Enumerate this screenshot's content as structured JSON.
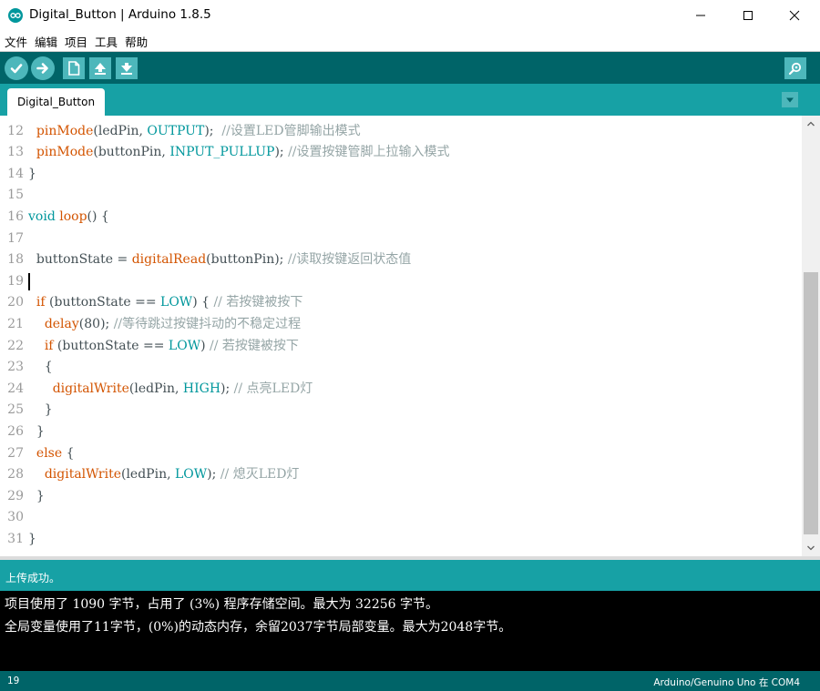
{
  "window": {
    "title": "Digital_Button | Arduino 1.8.5"
  },
  "menu": {
    "items": [
      "文件",
      "编辑",
      "项目",
      "工具",
      "帮助"
    ]
  },
  "toolbar": {
    "buttons": [
      "verify-icon",
      "upload-icon",
      "new-icon",
      "open-icon",
      "save-icon",
      "serial-monitor-icon"
    ]
  },
  "tabs": [
    {
      "label": "Digital_Button",
      "active": true
    }
  ],
  "editor": {
    "caret_line": 19,
    "lines": [
      {
        "num": "12",
        "segments": [
          {
            "t": "  ",
            "c": "plain"
          },
          {
            "t": "pinMode",
            "c": "kw"
          },
          {
            "t": "(ledPin, ",
            "c": "plain"
          },
          {
            "t": "OUTPUT",
            "c": "const"
          },
          {
            "t": ");  ",
            "c": "plain"
          },
          {
            "t": "//设置LED管脚输出模式",
            "c": "cmt"
          }
        ]
      },
      {
        "num": "13",
        "segments": [
          {
            "t": "  ",
            "c": "plain"
          },
          {
            "t": "pinMode",
            "c": "kw"
          },
          {
            "t": "(buttonPin, ",
            "c": "plain"
          },
          {
            "t": "INPUT_PULLUP",
            "c": "const"
          },
          {
            "t": "); ",
            "c": "plain"
          },
          {
            "t": "//设置按键管脚上拉输入模式",
            "c": "cmt"
          }
        ]
      },
      {
        "num": "14",
        "segments": [
          {
            "t": "}",
            "c": "plain"
          }
        ]
      },
      {
        "num": "15",
        "segments": []
      },
      {
        "num": "16",
        "segments": [
          {
            "t": "void",
            "c": "type"
          },
          {
            "t": " ",
            "c": "plain"
          },
          {
            "t": "loop",
            "c": "kw"
          },
          {
            "t": "() {",
            "c": "plain"
          }
        ]
      },
      {
        "num": "17",
        "segments": []
      },
      {
        "num": "18",
        "segments": [
          {
            "t": "  buttonState = ",
            "c": "plain"
          },
          {
            "t": "digitalRead",
            "c": "kw"
          },
          {
            "t": "(buttonPin); ",
            "c": "plain"
          },
          {
            "t": "//读取按键返回状态值",
            "c": "cmt"
          }
        ]
      },
      {
        "num": "19",
        "segments": []
      },
      {
        "num": "20",
        "segments": [
          {
            "t": "  ",
            "c": "plain"
          },
          {
            "t": "if",
            "c": "kw"
          },
          {
            "t": " (buttonState == ",
            "c": "plain"
          },
          {
            "t": "LOW",
            "c": "const"
          },
          {
            "t": ") { ",
            "c": "plain"
          },
          {
            "t": "// 若按键被按下",
            "c": "cmt"
          }
        ]
      },
      {
        "num": "21",
        "segments": [
          {
            "t": "    ",
            "c": "plain"
          },
          {
            "t": "delay",
            "c": "kw"
          },
          {
            "t": "(80); ",
            "c": "plain"
          },
          {
            "t": "//等待跳过按键抖动的不稳定过程",
            "c": "cmt"
          }
        ]
      },
      {
        "num": "22",
        "segments": [
          {
            "t": "    ",
            "c": "plain"
          },
          {
            "t": "if",
            "c": "kw"
          },
          {
            "t": " (buttonState == ",
            "c": "plain"
          },
          {
            "t": "LOW",
            "c": "const"
          },
          {
            "t": ") ",
            "c": "plain"
          },
          {
            "t": "// 若按键被按下",
            "c": "cmt"
          }
        ]
      },
      {
        "num": "23",
        "segments": [
          {
            "t": "    {",
            "c": "plain"
          }
        ]
      },
      {
        "num": "24",
        "segments": [
          {
            "t": "      ",
            "c": "plain"
          },
          {
            "t": "digitalWrite",
            "c": "kw"
          },
          {
            "t": "(ledPin, ",
            "c": "plain"
          },
          {
            "t": "HIGH",
            "c": "const"
          },
          {
            "t": "); ",
            "c": "plain"
          },
          {
            "t": "// 点亮LED灯",
            "c": "cmt"
          }
        ]
      },
      {
        "num": "25",
        "segments": [
          {
            "t": "    }",
            "c": "plain"
          }
        ]
      },
      {
        "num": "26",
        "segments": [
          {
            "t": "  }",
            "c": "plain"
          }
        ]
      },
      {
        "num": "27",
        "segments": [
          {
            "t": "  ",
            "c": "plain"
          },
          {
            "t": "else",
            "c": "kw"
          },
          {
            "t": " {",
            "c": "plain"
          }
        ]
      },
      {
        "num": "28",
        "segments": [
          {
            "t": "    ",
            "c": "plain"
          },
          {
            "t": "digitalWrite",
            "c": "kw"
          },
          {
            "t": "(ledPin, ",
            "c": "plain"
          },
          {
            "t": "LOW",
            "c": "const"
          },
          {
            "t": "); ",
            "c": "plain"
          },
          {
            "t": "// 熄灭LED灯",
            "c": "cmt"
          }
        ]
      },
      {
        "num": "29",
        "segments": [
          {
            "t": "  }",
            "c": "plain"
          }
        ]
      },
      {
        "num": "30",
        "segments": []
      },
      {
        "num": "31",
        "segments": [
          {
            "t": "}",
            "c": "plain"
          }
        ]
      }
    ]
  },
  "status": {
    "message": "上传成功。"
  },
  "console": {
    "lines": [
      "项目使用了 1090 字节，占用了 (3%) 程序存储空间。最大为 32256 字节。",
      "全局变量使用了11字节，(0%)的动态内存，余留2037字节局部变量。最大为2048字节。"
    ]
  },
  "footer": {
    "line_number": "19",
    "board": "Arduino/Genuino Uno 在 COM4"
  },
  "colors": {
    "toolbar": "#006468",
    "tabbar": "#17a1a5",
    "button": "#4db7bb",
    "keyword": "#d35400",
    "constant": "#00979c",
    "comment": "#95a5a6"
  }
}
